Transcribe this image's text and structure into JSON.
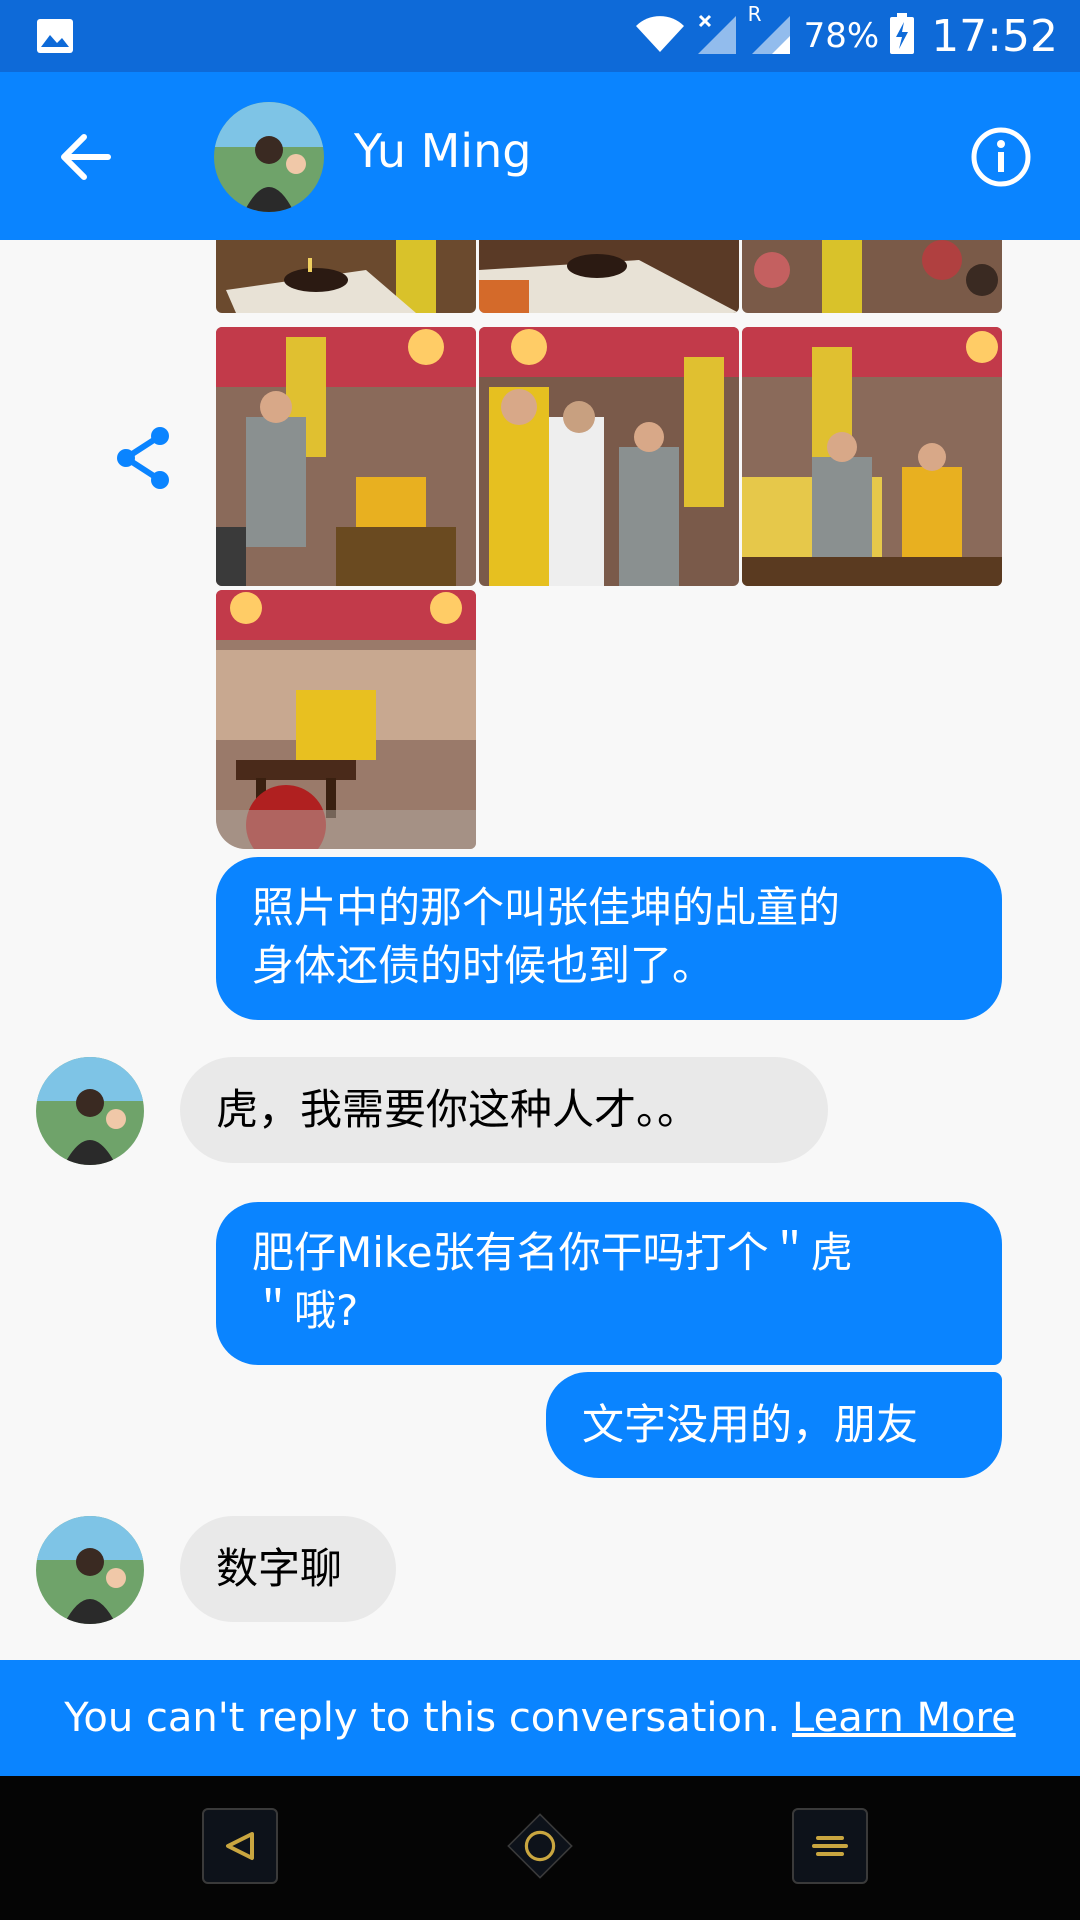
{
  "status_bar": {
    "battery": "78%",
    "time": "17:52",
    "carrier_tag": "R"
  },
  "header": {
    "contact_name": "Yu Ming"
  },
  "messages": [
    {
      "text": "照片中的那个叫张佳坤的乩童的\n身体还债的时候也到了。"
    },
    {
      "text": "虎，我需要你这种人才。。"
    },
    {
      "text": "肥仔Mike张有名你干吗打个＂虎\n＂哦?"
    },
    {
      "text": "文字没用的，朋友"
    },
    {
      "text": "数字聊"
    }
  ],
  "footer": {
    "notice": "You can't reply to this conversation.",
    "link": "Learn More"
  },
  "icons": [
    "gallery-icon",
    "wifi-icon",
    "signal-icon",
    "battery-icon",
    "back-arrow-icon",
    "info-icon",
    "share-icon",
    "back-triangle-icon",
    "home-circle-icon",
    "menu-icon"
  ],
  "colors": {
    "header": "#0a84ff",
    "status_bar": "#0e6ad8",
    "outgoing_bubble": "#0a84ff",
    "incoming_bubble": "#e9e9e9"
  }
}
